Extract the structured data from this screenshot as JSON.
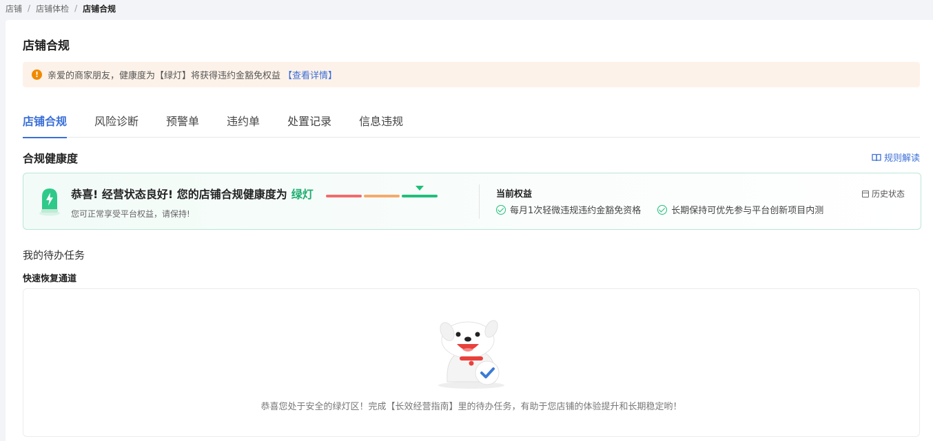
{
  "breadcrumb": {
    "items": [
      "店铺",
      "店铺体检",
      "店铺合规"
    ],
    "separator": "/"
  },
  "page": {
    "title": "店铺合规"
  },
  "notice": {
    "icon": "warning-icon",
    "text": "亲爱的商家朋友，健康度为【绿灯】将获得违约金豁免权益",
    "link": "【查看详情】"
  },
  "tabs": [
    {
      "label": "店铺合规",
      "active": true
    },
    {
      "label": "风险诊断",
      "active": false
    },
    {
      "label": "预警单",
      "active": false
    },
    {
      "label": "违约单",
      "active": false
    },
    {
      "label": "处置记录",
      "active": false
    },
    {
      "label": "信息违规",
      "active": false
    }
  ],
  "health": {
    "section_title": "合规健康度",
    "rules_link": "规则解读",
    "main_text": "恭喜! 经营状态良好! 您的店铺合规健康度为",
    "status": "绿灯",
    "sub_text": "您可正常享受平台权益，请保持!",
    "meter": {
      "levels": [
        "red",
        "orange",
        "green"
      ],
      "current": "green"
    },
    "colors": {
      "green": "#1fae70",
      "red": "#f26b6b",
      "orange": "#f6a96a"
    },
    "rights_title": "当前权益",
    "rights": [
      "每月1次轻微违规违约金豁免资格",
      "长期保持可优先参与平台创新项目内测"
    ],
    "history": "历史状态"
  },
  "todo": {
    "title": "我的待办任务",
    "fast_title": "快速恢复通道",
    "empty_text": "恭喜您处于安全的绿灯区！完成【长效经营指南】里的待办任务，有助于您店铺的体验提升和长期稳定哟！"
  }
}
